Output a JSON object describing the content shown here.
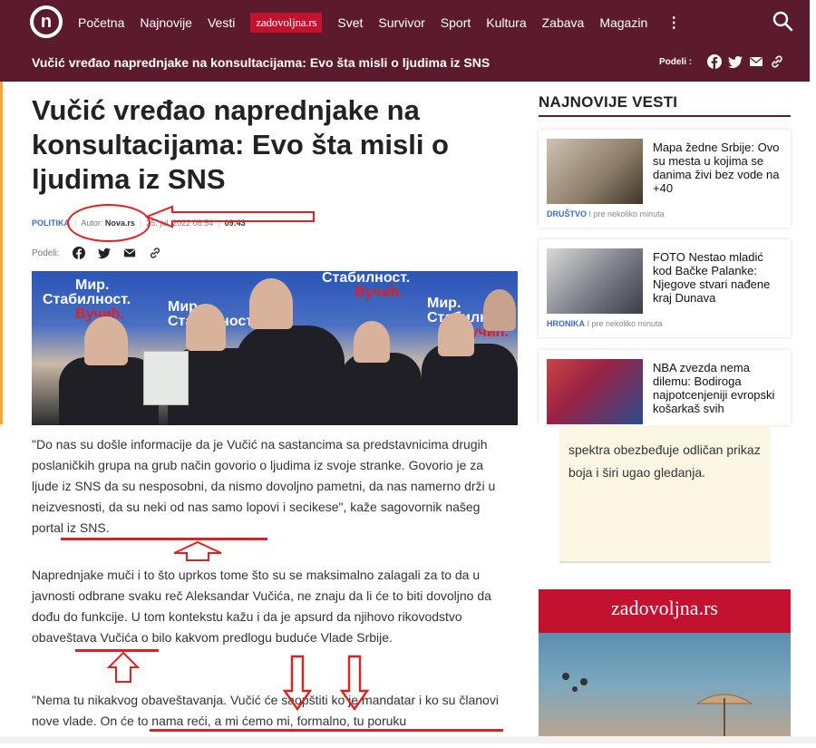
{
  "topbar": {
    "logo_text": "n",
    "nav": [
      "Početna",
      "Najnovije",
      "Vesti"
    ],
    "nav_zad": "zadovoljna.rs",
    "nav_rest": [
      "Svet",
      "Survivor",
      "Sport",
      "Kultura",
      "Zabava",
      "Magazin"
    ],
    "more_icon": "more-vertical-icon",
    "search_icon": "search-icon",
    "article_title": "Vučić vređao naprednjake na konsultacijama: Evo šta misli o ljudima iz SNS",
    "share_label": "Podeli :",
    "share_icons": [
      "facebook-icon",
      "twitter-icon",
      "email-icon",
      "link-icon"
    ]
  },
  "article": {
    "headline": "Vučić vređao naprednjake na konsultacijama: Evo šta misli o ljudima iz SNS",
    "category": "POLITIKA",
    "author_label": "Autor:",
    "author": "Nova.rs",
    "date": "25. jul. 2022 08:54",
    "updated": "09:43",
    "share_label": "Podeli:",
    "photo_banner_1": "Мир.",
    "photo_banner_2": "Стабилност.",
    "photo_banner_3": "Вучић.",
    "photo_banner_4": "Мир.",
    "photo_banner_5": "Стабилност.",
    "photo_banner_6": "Вучић.",
    "p1": "\"Do nas su došle informacije da je Vučić na sastancima sa predstavnicima drugih poslaničkih grupa na grub način govorio o ljudima iz svoje stranke. Govorio je za ljude iz SNS da su nesposobni, da nismo dovoljno pametni, da nas namerno drži u neizvesnosti, da su neki od nas samo lopovi i secikese\", kaže sagovornik našeg portal iz SNS.",
    "p2": "Naprednjake muči i to što uprkos tome što su se maksimalno zalagali za to da u javnosti odbrane svaku reč Aleksandar Vučića, ne znaju da li će to biti dovoljno da dođu do funkcije. U tom kontekstu kažu i da je apsurd da njihovo rikovodstvo obaveštava Vučića o bilo kakvom predlogu buduće Vlade Srbije.",
    "p3": "\"Nema tu nikakvog obaveštavanja. Vučić će saopštiti ko je mandatar i ko su članovi nove vlade. On će to nama reći, a mi ćemo mi, formalno, tu poruku"
  },
  "sidebar": {
    "title": "NAJNOVIJE VESTI",
    "cards": [
      {
        "title": "Mapa žedne Srbije: Ovo su mesta u kojima se danima živi bez vode na +40",
        "cat": "DRUŠTVO",
        "time": "pre nekoliko minuta"
      },
      {
        "title": "FOTO Nestao mladić kod Bačke Palanke: Njegove stvari nađene kraj Dunava",
        "cat": "HRONIKA",
        "time": "pre nekoliko minuta"
      },
      {
        "title": "NBA zvezda nema dilemu: Bodiroga najpotcenjeniji evropski košarkaš svih",
        "cat": "",
        "time": ""
      }
    ],
    "ad_text": "spektra obezbeđuje odličan prikaz boja i širi ugao gledanja.",
    "promo_brand": "zadovoljna.rs"
  },
  "colors": {
    "brand": "#5c1b2c",
    "accent": "#c2122f",
    "annotation": "#e02020",
    "link": "#3b6cc5"
  }
}
